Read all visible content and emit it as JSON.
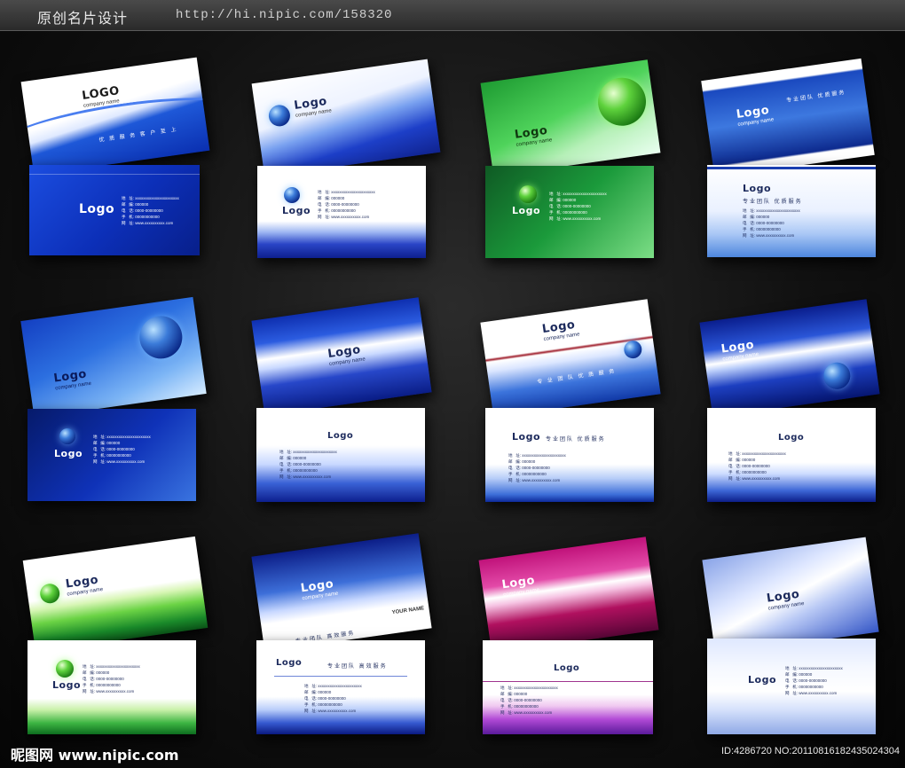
{
  "header": {
    "title": "原创名片设计",
    "url": "http://hi.nipic.com/158320"
  },
  "card_text": {
    "logo": "LOGO",
    "logo_mixed": "Logo",
    "company": "company name",
    "slogan_a": "优 质 服 务     客 户 至 上",
    "slogan_b": "专 业 团 队     优 质 服 务",
    "slogan_c": "专业团队  优质服务",
    "slogan_d": "专业团队  高效服务",
    "your_name": "YOUR NAME",
    "info_lines": "地   址: xxxxxxxxxxxxxxxxxxxxxx\n邮   编: 000000\n电   话: 0000-00000000\n手   机: 00000000000\n网   址: www.xxxxxxxxxx.com"
  },
  "footer": {
    "site": "昵图网 www.nipic.com",
    "id": "ID:4286720 NO:20110816182435024304"
  },
  "colors": {
    "blue": "#0a2fb0",
    "deep_blue": "#061a6a",
    "green": "#1fae3c",
    "magenta": "#c0127a",
    "white": "#ffffff"
  }
}
